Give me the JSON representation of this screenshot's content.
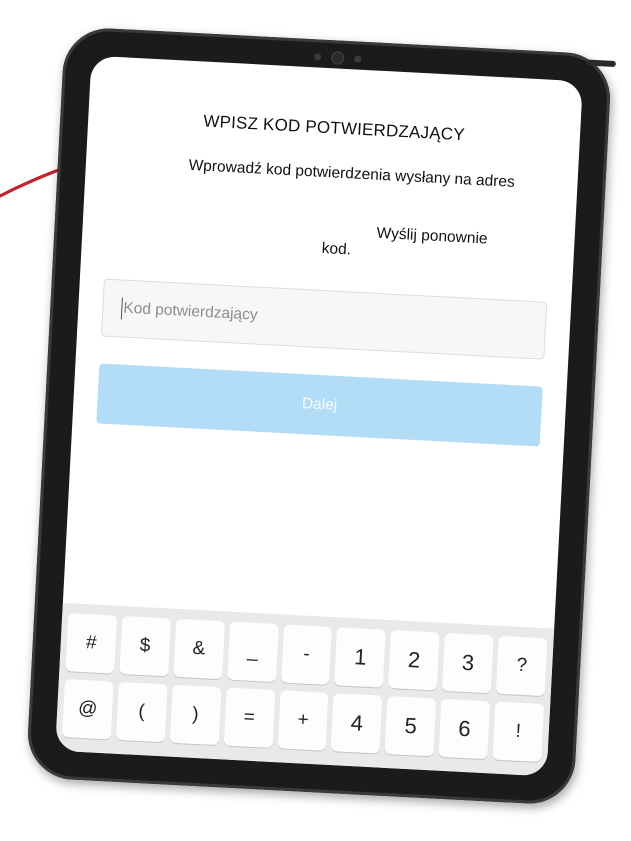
{
  "screen": {
    "title": "WPISZ KOD POTWIERDZAJĄCY",
    "description": "Wprowadź kod potwierdzenia wysłany na adres",
    "resend_line1": "Wyślij ponownie",
    "resend_line2": "kod.",
    "code_input": {
      "placeholder": "Kod potwierdzający",
      "value": ""
    },
    "next_button": "Dalej"
  },
  "keyboard": {
    "row1": [
      "#",
      "$",
      "&",
      "_",
      "-",
      "1",
      "2",
      "3",
      "?"
    ],
    "row2": [
      "@",
      "(",
      ")",
      "=",
      "+",
      "4",
      "5",
      "6",
      "!"
    ]
  },
  "colors": {
    "annotation_arrow": "#c0222b",
    "next_button_disabled": "#b3ddf7",
    "device_frame": "#1b1b1b"
  }
}
